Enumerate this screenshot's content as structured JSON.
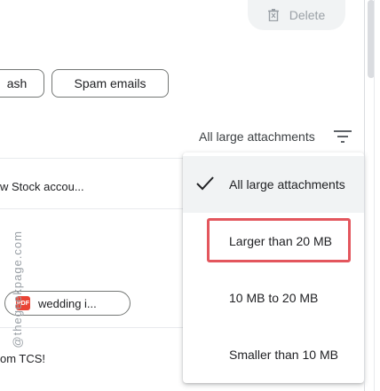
{
  "toolbar": {
    "delete_label": "Delete",
    "delete_icon": "trash-icon"
  },
  "chips": {
    "trash": "ash",
    "spam": "Spam emails"
  },
  "filter": {
    "label": "All large attachments",
    "icon": "filter-lines-icon"
  },
  "rows": {
    "row1": "w Stock accou...",
    "attachment": "wedding i...",
    "attachment_badge": "PDF",
    "row3": "om TCS!"
  },
  "menu": {
    "items": [
      {
        "label": "All large attachments",
        "selected": true
      },
      {
        "label": "Larger than 20 MB",
        "selected": false,
        "highlighted": true
      },
      {
        "label": "10 MB to 20 MB",
        "selected": false
      },
      {
        "label": "Smaller than 10 MB",
        "selected": false
      }
    ]
  },
  "watermark": "@thegeekpage.com",
  "colors": {
    "highlight": "#e3565d",
    "pdf": "#ea4335",
    "menu_selected_bg": "#f1f3f4"
  }
}
